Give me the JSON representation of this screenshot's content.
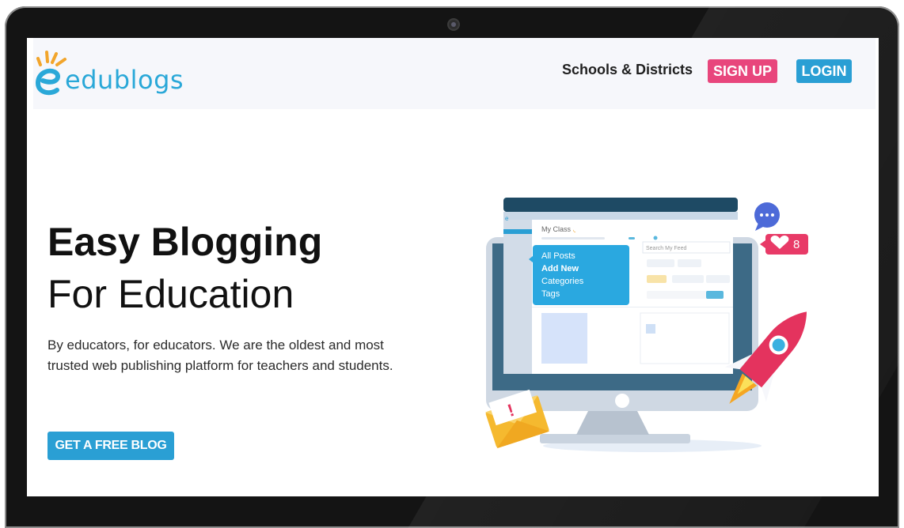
{
  "brand": {
    "name": "edublogs"
  },
  "nav": {
    "link_schools": "Schools & Districts",
    "signup_label": "SIGN UP",
    "login_label": "LOGIN"
  },
  "hero": {
    "title_line1": "Easy Blogging",
    "title_line2": "For Education",
    "description": "By educators, for educators. We are the oldest and most trusted web publishing platform for teachers and students.",
    "cta_label": "GET A FREE BLOG"
  },
  "illustration": {
    "panel_title": "My Class",
    "search_label": "Search My Feed",
    "menu_items": [
      "All Posts",
      "Add New",
      "Categories",
      "Tags"
    ],
    "likes_count": "8"
  },
  "colors": {
    "brand_blue": "#2a9fd4",
    "signup_pink": "#e8467c",
    "nav_background": "#f6f7fb"
  },
  "icons": {
    "logo": "edublogs-e-logo",
    "chat": "chat-bubble-icon",
    "like": "heart-icon",
    "mail": "envelope-alert-icon",
    "rocket": "rocket-icon",
    "rss": "rss-icon"
  }
}
